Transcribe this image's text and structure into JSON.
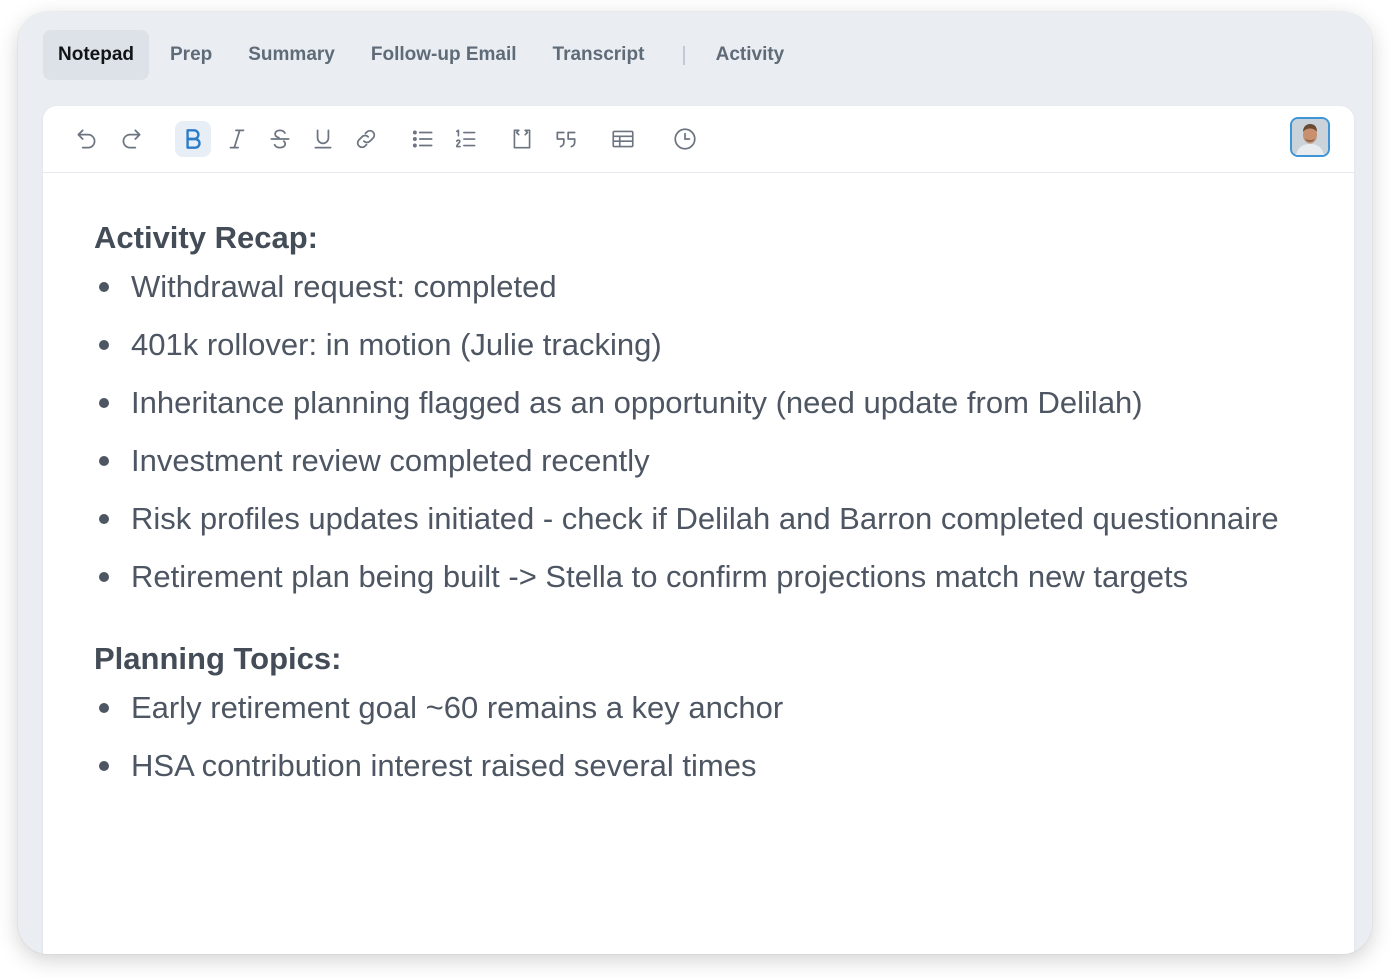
{
  "tabs": [
    {
      "label": "Notepad",
      "active": true
    },
    {
      "label": "Prep"
    },
    {
      "label": "Summary"
    },
    {
      "label": "Follow-up Email"
    },
    {
      "label": "Transcript"
    },
    {
      "label": "Activity"
    }
  ],
  "tab_separator": "|",
  "toolbar": {
    "icons": [
      "undo-icon",
      "redo-icon",
      "bold-icon",
      "italic-icon",
      "strikethrough-icon",
      "underline-icon",
      "link-icon",
      "bullet-list-icon",
      "numbered-list-icon",
      "code-block-icon",
      "quote-icon",
      "table-icon",
      "clock-icon"
    ],
    "active": "bold-icon",
    "accent_color": "#2b7cc7"
  },
  "avatar": {
    "icon": "user-avatar"
  },
  "notes": {
    "section1": {
      "heading": "Activity Recap:",
      "items": [
        "Withdrawal request: completed",
        "401k rollover: in motion (Julie tracking)",
        "Inheritance planning flagged as an opportunity (need update from Delilah)",
        "Investment review completed recently",
        "Risk profiles updates initiated - check if Delilah and Barron completed questionnaire",
        "Retirement plan being built -> Stella to confirm projections match new targets"
      ]
    },
    "section2": {
      "heading": "Planning Topics:",
      "items": [
        "Early retirement goal ~60 remains a key anchor",
        "HSA contribution interest raised several times"
      ]
    }
  }
}
